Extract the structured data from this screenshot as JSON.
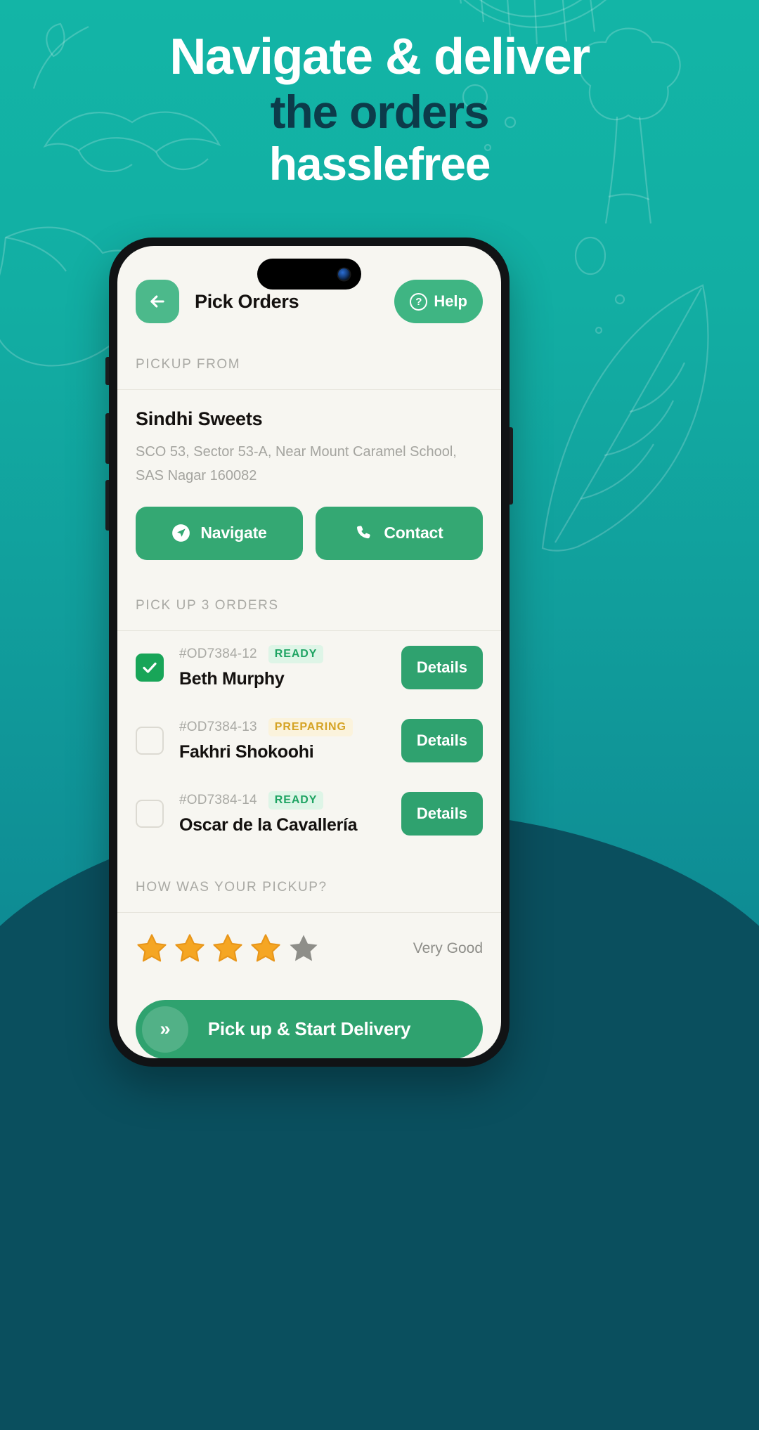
{
  "headline": {
    "line1": "Navigate & deliver",
    "line2": "the orders",
    "line3": "hasslefree"
  },
  "colors": {
    "bg_top": "#13B5A6",
    "bg_bottom": "#0A4F5E",
    "accent_green": "#2FA26F",
    "headline_dark": "#0C3B4A",
    "screen_bg": "#F7F6F1",
    "ready_badge": "#1FA463",
    "preparing_badge": "#D5A324",
    "star_filled": "#F5A623",
    "star_empty": "#8E8E89"
  },
  "app": {
    "header": {
      "back_icon": "arrow-left-icon",
      "title": "Pick Orders",
      "help_icon": "question-circle-icon",
      "help_label": "Help"
    },
    "pickup_section": {
      "label": "PICKUP FROM",
      "store_name": "Sindhi Sweets",
      "address_line1": "SCO 53, Sector 53-A, Near Mount Caramel School,",
      "address_line2": "SAS Nagar 160082",
      "actions": [
        {
          "label": "Navigate",
          "icon": "navigation-arrow-icon"
        },
        {
          "label": "Contact",
          "icon": "phone-icon"
        }
      ]
    },
    "orders_section": {
      "label": "PICK UP 3 ORDERS",
      "details_label": "Details",
      "orders": [
        {
          "checked": true,
          "id": "#OD7384-12",
          "status": "READY",
          "status_kind": "ready",
          "name": "Beth Murphy",
          "details_label": "Details"
        },
        {
          "checked": false,
          "id": "#OD7384-13",
          "status": "PREPARING",
          "status_kind": "preparing",
          "name": "Fakhri Shokoohi",
          "details_label": "Details"
        },
        {
          "checked": false,
          "id": "#OD7384-14",
          "status": "READY",
          "status_kind": "ready",
          "name": "Oscar de la Cavallería",
          "details_label": "Details"
        }
      ]
    },
    "rating_section": {
      "label": "HOW WAS YOUR PICKUP?",
      "stars_total": 5,
      "stars_filled": 4,
      "rating_text": "Very Good"
    },
    "cta": {
      "chevron": "»",
      "label": "Pick up & Start Delivery"
    }
  }
}
